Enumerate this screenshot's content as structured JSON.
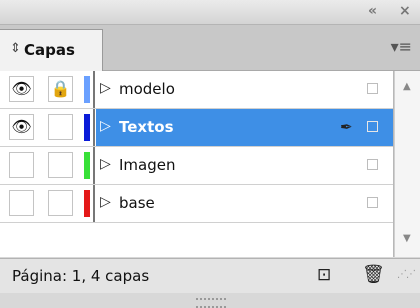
{
  "panel": {
    "collapse_icon": "double-chevron-left",
    "close_icon": "close",
    "tab": {
      "icon": "updown-arrows",
      "label": "Capas"
    },
    "menu_icon": "panel-menu"
  },
  "layers": [
    {
      "name": "modelo",
      "visible": true,
      "locked": true,
      "color": "#6aa0ff",
      "selected": false
    },
    {
      "name": "Textos",
      "visible": true,
      "locked": false,
      "color": "#0a1bd8",
      "selected": true,
      "pen_icon": "pen-nib"
    },
    {
      "name": "Imagen",
      "visible": false,
      "locked": false,
      "color": "#38e038",
      "selected": false
    },
    {
      "name": "base",
      "visible": false,
      "locked": false,
      "color": "#e41818",
      "selected": false
    }
  ],
  "footer": {
    "status": "Página: 1, 4 capas",
    "new_layer_icon": "new-layer",
    "delete_icon": "trash"
  }
}
